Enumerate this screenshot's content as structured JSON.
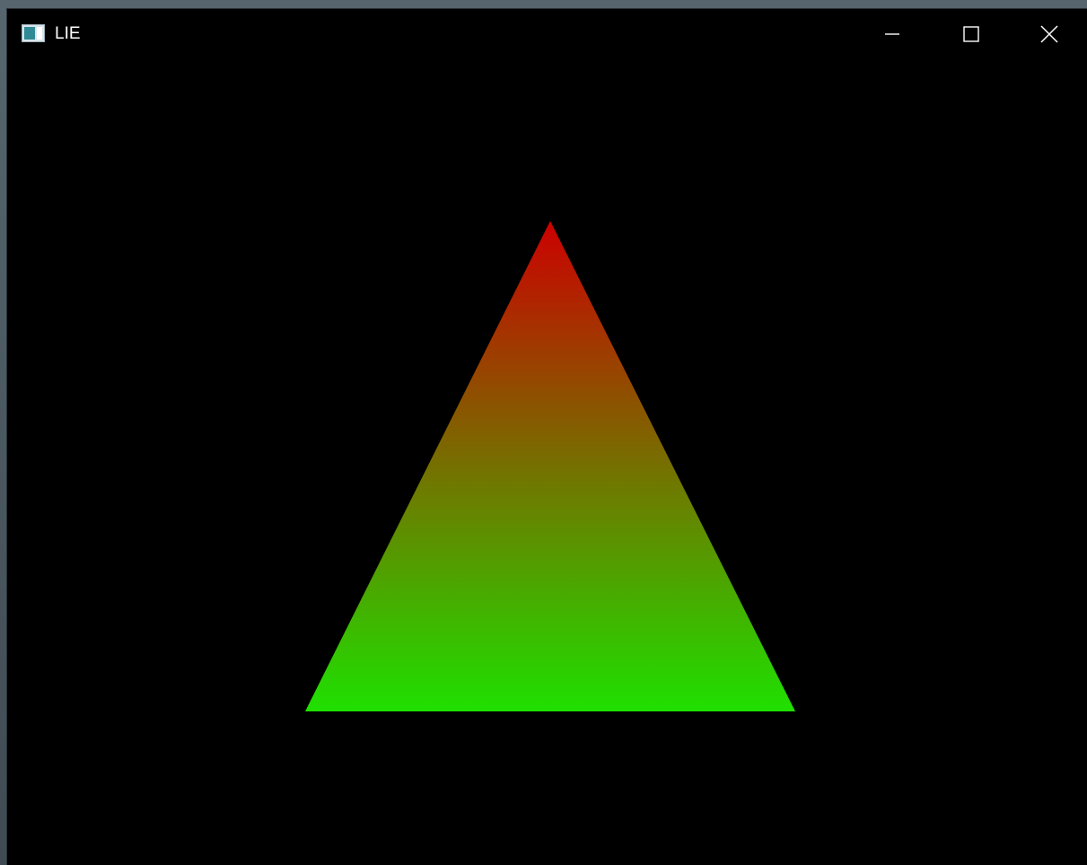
{
  "window": {
    "title": "LIE",
    "icon": "window-app-icon",
    "buttons": {
      "minimize_icon": "minimize-icon",
      "maximize_icon": "maximize-icon",
      "close_icon": "close-icon"
    }
  },
  "scene": {
    "background_color": "#000000",
    "shape": "triangle",
    "gradient": {
      "top_color": "#cc0000",
      "bottom_color": "#1fe000"
    }
  }
}
